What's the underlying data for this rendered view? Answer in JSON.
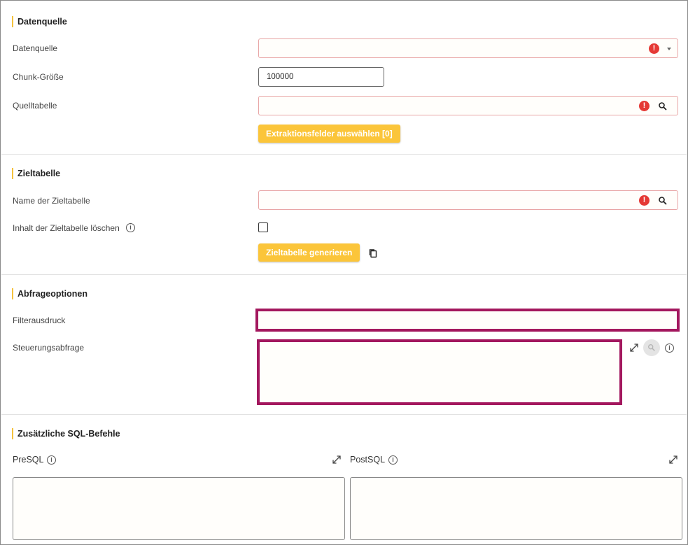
{
  "sections": {
    "datasource": {
      "title": "Datenquelle",
      "source_label": "Datenquelle",
      "chunk_label": "Chunk-Größe",
      "chunk_value": "100000",
      "table_label": "Quelltabelle",
      "extract_button": "Extraktionsfelder auswählen [0]"
    },
    "target": {
      "title": "Zieltabelle",
      "name_label": "Name der Zieltabelle",
      "clear_label": "Inhalt der Zieltabelle löschen",
      "generate_button": "Zieltabelle generieren"
    },
    "query": {
      "title": "Abfrageoptionen",
      "filter_label": "Filterausdruck",
      "control_label": "Steuerungsabfrage"
    },
    "sql": {
      "title": "Zusätzliche SQL-Befehle",
      "presql_label": "PreSQL",
      "postsql_label": "PostSQL"
    }
  },
  "icons": {
    "error": "!",
    "info": "i"
  },
  "colors": {
    "accent": "#fbc53a",
    "error": "#e53935",
    "highlight": "#a3175e"
  }
}
